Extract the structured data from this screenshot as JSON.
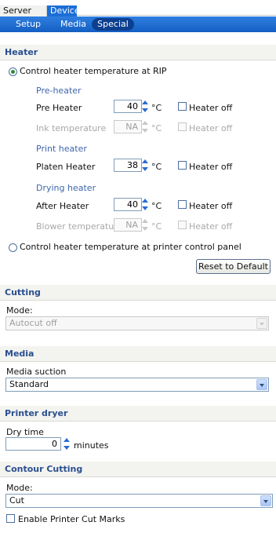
{
  "tabs": {
    "server": "Server",
    "device": "Device"
  },
  "subtabs": {
    "setup": "Setup",
    "media": "Media",
    "special": "Special"
  },
  "heater": {
    "title": "Heater",
    "rip_control_label": "Control heater temperature at RIP",
    "preheater_group": "Pre-heater",
    "preheater_label": "Pre Heater",
    "preheater_value": "40",
    "unit": "°C",
    "heater_off_label": "Heater off",
    "ink_temp_label": "Ink temperature",
    "ink_temp_value": "NA",
    "print_heater_group": "Print heater",
    "platen_label": "Platen Heater",
    "platen_value": "38",
    "drying_group": "Drying heater",
    "after_label": "After Heater",
    "after_value": "40",
    "blower_label": "Blower temperature",
    "blower_value": "NA",
    "printer_panel_label": "Control heater temperature at printer control panel",
    "reset_label": "Reset to Default"
  },
  "cutting": {
    "title": "Cutting",
    "mode_label": "Mode:",
    "mode_value": "Autocut off"
  },
  "media": {
    "title": "Media",
    "suction_label": "Media suction",
    "suction_value": "Standard"
  },
  "dryer": {
    "title": "Printer dryer",
    "dry_time_label": "Dry time",
    "dry_time_value": "0",
    "minutes_label": "minutes"
  },
  "contour": {
    "title": "Contour Cutting",
    "mode_label": "Mode:",
    "mode_value": "Cut",
    "cut_marks_label": "Enable Printer Cut Marks"
  }
}
